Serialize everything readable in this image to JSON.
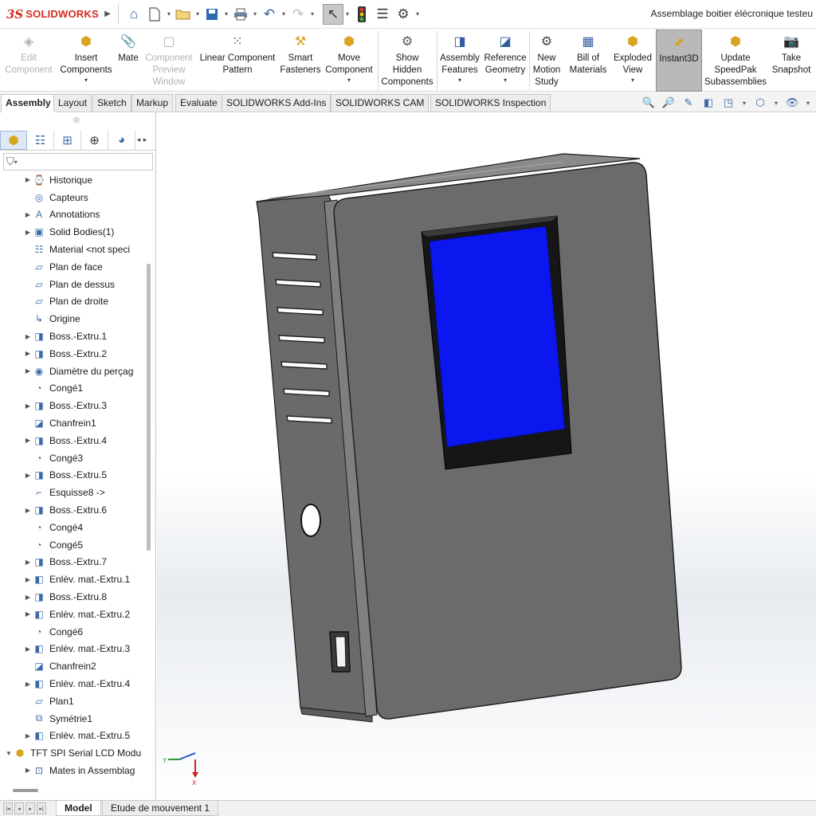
{
  "app": {
    "brand_mark": "3S",
    "brand_name": "SOLIDWORKS",
    "document_title": "Assemblage boitier élécronique testeu"
  },
  "quick_access": [
    {
      "name": "home-icon",
      "glyph": "⌂"
    },
    {
      "name": "new-document-icon",
      "glyph": "🗋"
    },
    {
      "name": "open-folder-icon",
      "glyph": "📂"
    },
    {
      "name": "save-icon",
      "glyph": "💾"
    },
    {
      "name": "print-icon",
      "glyph": "🖶"
    },
    {
      "name": "undo-icon",
      "glyph": "↶"
    },
    {
      "name": "redo-icon",
      "glyph": "↷"
    },
    {
      "name": "select-pointer-icon",
      "glyph": "↖"
    },
    {
      "name": "rebuild-traffic-light-icon",
      "glyph": "🚦"
    },
    {
      "name": "file-properties-icon",
      "glyph": "☰"
    },
    {
      "name": "options-gear-icon",
      "glyph": "⚙"
    }
  ],
  "commands": {
    "edit_component": "Edit\nComponent",
    "insert_components": "Insert\nComponents",
    "mate": "Mate",
    "component_preview": "Component\nPreview\nWindow",
    "linear_pattern": "Linear Component\nPattern",
    "smart_fasteners": "Smart\nFasteners",
    "move_component": "Move\nComponent",
    "show_hidden": "Show\nHidden\nComponents",
    "assembly_features": "Assembly\nFeatures",
    "reference_geometry": "Reference\nGeometry",
    "new_motion_study": "New\nMotion\nStudy",
    "bill_of_materials": "Bill of\nMaterials",
    "exploded_view": "Exploded\nView",
    "instant3d": "Instant3D",
    "update_speedpak": "Update\nSpeedPak\nSubassemblies",
    "take_snapshot": "Take\nSnapshot"
  },
  "tabs": [
    "Assembly",
    "Layout",
    "Sketch",
    "Markup",
    "Evaluate",
    "SOLIDWORKS Add-Ins",
    "SOLIDWORKS CAM",
    "SOLIDWORKS Inspection"
  ],
  "active_tab": "Assembly",
  "view_tools": [
    {
      "name": "zoom-to-fit-icon",
      "glyph": "🔍"
    },
    {
      "name": "zoom-to-area-icon",
      "glyph": "🔎"
    },
    {
      "name": "previous-view-icon",
      "glyph": "✎"
    },
    {
      "name": "section-view-icon",
      "glyph": "◧"
    },
    {
      "name": "view-orientation-icon",
      "glyph": "◳"
    },
    {
      "name": "display-style-icon",
      "glyph": "⬡"
    },
    {
      "name": "hide-show-items-icon",
      "glyph": "👁"
    }
  ],
  "tree": [
    {
      "label": "Historique",
      "icon": "history-icon",
      "glyph": "⌚",
      "expandable": true,
      "indent": 1
    },
    {
      "label": "Capteurs",
      "icon": "sensors-icon",
      "glyph": "◎",
      "expandable": false,
      "indent": 1
    },
    {
      "label": "Annotations",
      "icon": "annotations-icon",
      "glyph": "A",
      "expandable": true,
      "indent": 1
    },
    {
      "label": "Solid Bodies(1)",
      "icon": "solid-bodies-icon",
      "glyph": "▣",
      "expandable": true,
      "indent": 1
    },
    {
      "label": "Material <not speci",
      "icon": "material-icon",
      "glyph": "☷",
      "expandable": false,
      "indent": 1
    },
    {
      "label": "Plan de face",
      "icon": "plane-icon",
      "glyph": "▱",
      "expandable": false,
      "indent": 1
    },
    {
      "label": "Plan de dessus",
      "icon": "plane-icon",
      "glyph": "▱",
      "expandable": false,
      "indent": 1
    },
    {
      "label": "Plan de droite",
      "icon": "plane-icon",
      "glyph": "▱",
      "expandable": false,
      "indent": 1
    },
    {
      "label": "Origine",
      "icon": "origin-icon",
      "glyph": "↳",
      "expandable": false,
      "indent": 1
    },
    {
      "label": "Boss.-Extru.1",
      "icon": "boss-extrude-icon",
      "glyph": "◨",
      "expandable": true,
      "indent": 1
    },
    {
      "label": "Boss.-Extru.2",
      "icon": "boss-extrude-icon",
      "glyph": "◨",
      "expandable": true,
      "indent": 1
    },
    {
      "label": "Diamètre du perçag",
      "icon": "hole-wizard-icon",
      "glyph": "◉",
      "expandable": true,
      "indent": 1
    },
    {
      "label": "Congé1",
      "icon": "fillet-icon",
      "glyph": "◔",
      "expandable": false,
      "indent": 1
    },
    {
      "label": "Boss.-Extru.3",
      "icon": "boss-extrude-icon",
      "glyph": "◨",
      "expandable": true,
      "indent": 1
    },
    {
      "label": "Chanfrein1",
      "icon": "chamfer-icon",
      "glyph": "◪",
      "expandable": false,
      "indent": 1
    },
    {
      "label": "Boss.-Extru.4",
      "icon": "boss-extrude-icon",
      "glyph": "◨",
      "expandable": true,
      "indent": 1
    },
    {
      "label": "Congé3",
      "icon": "fillet-icon",
      "glyph": "◔",
      "expandable": false,
      "indent": 1
    },
    {
      "label": "Boss.-Extru.5",
      "icon": "boss-extrude-icon",
      "glyph": "◨",
      "expandable": true,
      "indent": 1
    },
    {
      "label": "Esquisse8 ->",
      "icon": "sketch-icon",
      "glyph": "⌐",
      "expandable": false,
      "indent": 1
    },
    {
      "label": "Boss.-Extru.6",
      "icon": "boss-extrude-icon",
      "glyph": "◨",
      "expandable": true,
      "indent": 1
    },
    {
      "label": "Congé4",
      "icon": "fillet-icon",
      "glyph": "◔",
      "expandable": false,
      "indent": 1
    },
    {
      "label": "Congé5",
      "icon": "fillet-icon",
      "glyph": "◔",
      "expandable": false,
      "indent": 1
    },
    {
      "label": "Boss.-Extru.7",
      "icon": "boss-extrude-icon",
      "glyph": "◨",
      "expandable": true,
      "indent": 1
    },
    {
      "label": "Enlèv. mat.-Extru.1",
      "icon": "cut-extrude-icon",
      "glyph": "◧",
      "expandable": true,
      "indent": 1
    },
    {
      "label": "Boss.-Extru.8",
      "icon": "boss-extrude-icon",
      "glyph": "◨",
      "expandable": true,
      "indent": 1
    },
    {
      "label": "Enlèv. mat.-Extru.2",
      "icon": "cut-extrude-icon",
      "glyph": "◧",
      "expandable": true,
      "indent": 1
    },
    {
      "label": "Congé6",
      "icon": "fillet-icon",
      "glyph": "◔",
      "expandable": false,
      "indent": 1
    },
    {
      "label": "Enlèv. mat.-Extru.3",
      "icon": "cut-extrude-icon",
      "glyph": "◧",
      "expandable": true,
      "indent": 1
    },
    {
      "label": "Chanfrein2",
      "icon": "chamfer-icon",
      "glyph": "◪",
      "expandable": false,
      "indent": 1
    },
    {
      "label": "Enlèv. mat.-Extru.4",
      "icon": "cut-extrude-icon",
      "glyph": "◧",
      "expandable": true,
      "indent": 1
    },
    {
      "label": "Plan1",
      "icon": "plane-icon",
      "glyph": "▱",
      "expandable": false,
      "indent": 1
    },
    {
      "label": "Symétrie1",
      "icon": "mirror-icon",
      "glyph": "⧉",
      "expandable": false,
      "indent": 1
    },
    {
      "label": "Enlèv. mat.-Extru.5",
      "icon": "cut-extrude-icon",
      "glyph": "◧",
      "expandable": true,
      "indent": 1
    },
    {
      "label": "TFT SPI Serial LCD Modu",
      "icon": "component-icon",
      "glyph": "⬢",
      "expandable": true,
      "expanded": true,
      "indent": 0
    },
    {
      "label": "Mates in Assemblag",
      "icon": "mates-icon",
      "glyph": "⊡",
      "expandable": true,
      "indent": 1
    }
  ],
  "bottom_tabs": [
    "Model",
    "Etude de mouvement 1"
  ],
  "active_bottom_tab": "Model",
  "triad_labels": {
    "x": "X",
    "y": "Y"
  },
  "colors": {
    "brand_red": "#d52b1e",
    "body_gray": "#6b6b6b",
    "screen_blue": "#0b17ee",
    "bezel": "#161616"
  }
}
